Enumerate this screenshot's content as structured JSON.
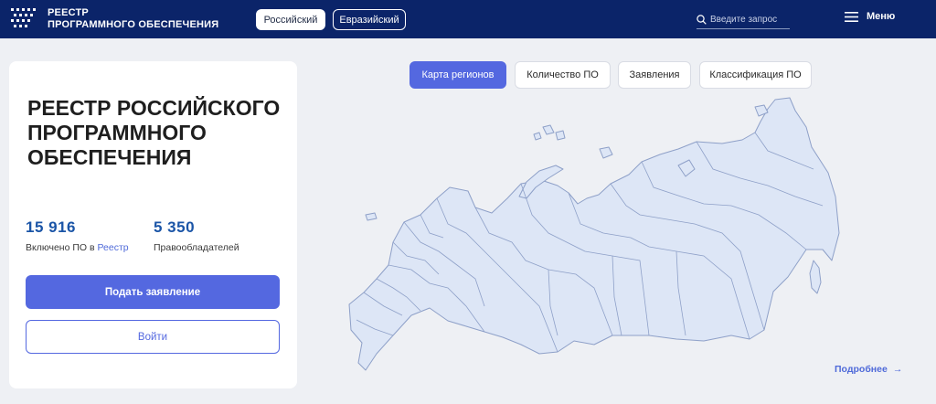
{
  "header": {
    "logo_line1": "РЕЕСТР",
    "logo_line2": "ПРОГРАММНОГО ОБЕСПЕЧЕНИЯ",
    "segments": [
      "Российский",
      "Евразийский"
    ],
    "search_placeholder": "Введите запрос",
    "menu_label": "Меню"
  },
  "card": {
    "title": "РЕЕСТР РОССИЙСКОГО ПРОГРАММНОГО ОБЕСПЕЧЕНИЯ",
    "stats": [
      {
        "value": "15 916",
        "caption_prefix": "Включено ПО в ",
        "caption_link": "Реестр"
      },
      {
        "value": "5 350",
        "caption": "Правообладателей"
      }
    ],
    "apply_label": "Подать заявление",
    "login_label": "Войти"
  },
  "tabs": [
    "Карта регионов",
    "Количество ПО",
    "Заявления",
    "Классификация ПО"
  ],
  "more_label": "Подробнее",
  "more_arrow": "→",
  "colors": {
    "header_bg": "#0b2469",
    "accent": "#5468e0",
    "stat_number": "#1b55a7",
    "map_fill": "#dde6f6",
    "map_stroke": "#8ea0c8",
    "page_bg": "#eef0f4"
  },
  "icons": [
    "logo-mark-icon",
    "search-icon",
    "hamburger-icon",
    "arrow-right-icon"
  ]
}
